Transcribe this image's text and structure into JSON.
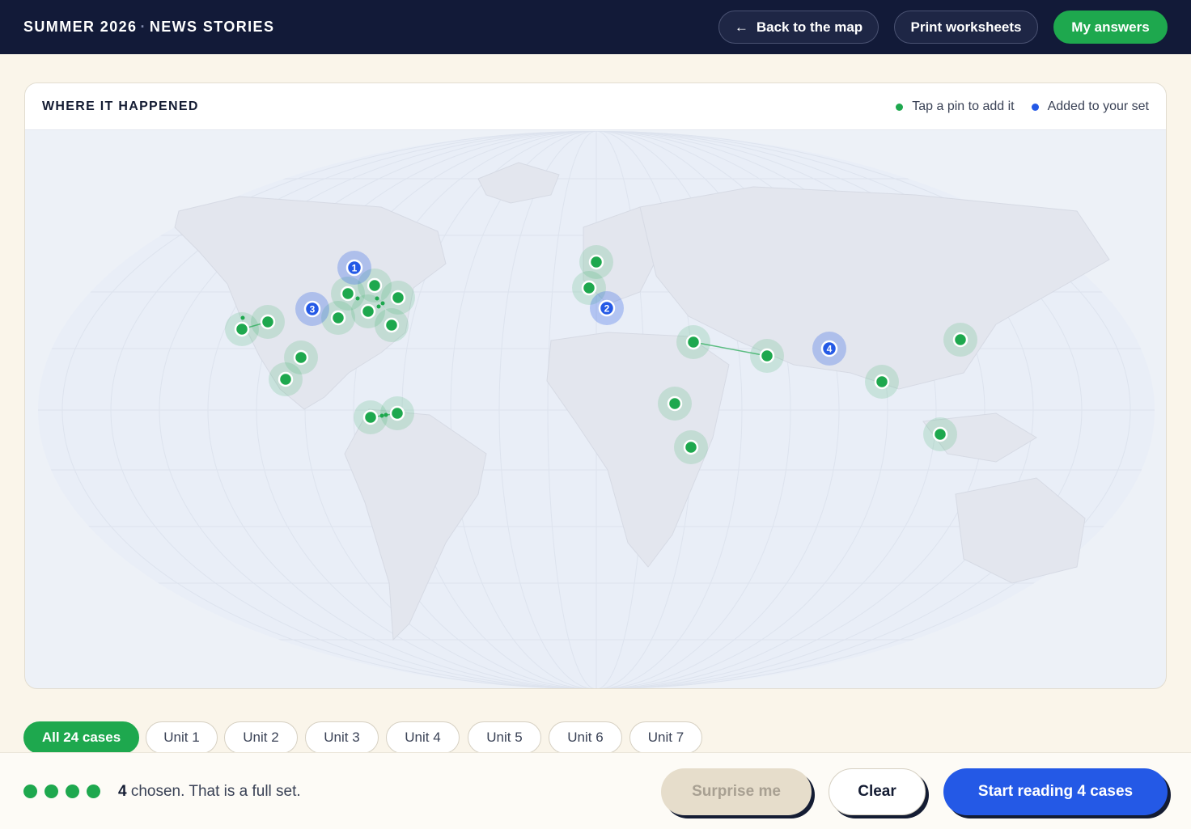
{
  "header": {
    "brand_left": "SUMMER 2026",
    "brand_sep": "·",
    "brand_right": "NEWS STORIES",
    "back_arrow": "←",
    "back_label": "Back to the map",
    "print_label": "Print worksheets",
    "answers_label": "My answers"
  },
  "map": {
    "title": "WHERE IT HAPPENED",
    "legend_available": "Tap a pin to add it",
    "legend_selected": "Added to your set",
    "colors": {
      "available": "#1ea84e",
      "selected": "#2459e6"
    },
    "selected_badges": [
      "1",
      "2",
      "3",
      "4"
    ],
    "pin_counts": {
      "available": 24,
      "selected": 4
    }
  },
  "filters": {
    "items": [
      "All 24 cases",
      "Unit 1",
      "Unit 2",
      "Unit 3",
      "Unit 4",
      "Unit 5",
      "Unit 6",
      "Unit 7"
    ],
    "active": "All 24 cases"
  },
  "footer": {
    "count": "4",
    "status_text": " chosen. That is a full set.",
    "surprise_label": "Surprise me",
    "clear_label": "Clear",
    "start_label": "Start reading 4 cases"
  }
}
